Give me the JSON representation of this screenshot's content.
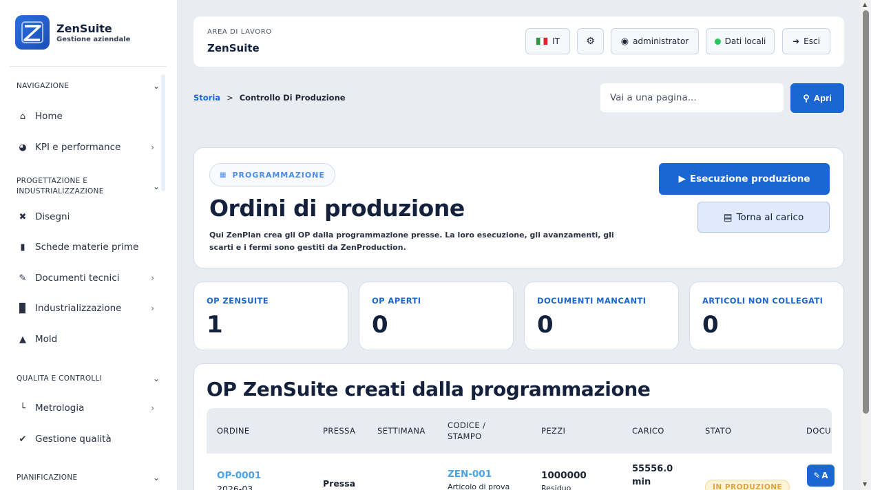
{
  "brand": {
    "name": "ZenSuite",
    "subtitle": "Gestione aziendale"
  },
  "sidebar": {
    "sections": [
      {
        "label": "NAVIGAZIONE"
      },
      {
        "label": "PROGETTAZIONE E INDUSTRIALIZZAZIONE"
      },
      {
        "label": "QUALITA E CONTROLLI"
      },
      {
        "label": "PIANIFICAZIONE"
      }
    ],
    "items": [
      {
        "label": "Home",
        "icon": "home-icon"
      },
      {
        "label": "KPI e performance",
        "icon": "pie-chart-icon"
      },
      {
        "label": "Disegni",
        "icon": "tools-icon"
      },
      {
        "label": "Schede materie prime",
        "icon": "file-icon"
      },
      {
        "label": "Documenti tecnici",
        "icon": "file-edit-icon"
      },
      {
        "label": "Industrializzazione",
        "icon": "industry-icon"
      },
      {
        "label": "Mold",
        "icon": "shapes-icon"
      },
      {
        "label": "Metrologia",
        "icon": "ruler-icon"
      },
      {
        "label": "Gestione qualità",
        "icon": "check-icon"
      }
    ]
  },
  "topbar": {
    "workspace_label": "AREA DI LAVORO",
    "workspace_name": "ZenSuite",
    "lang": "IT",
    "user": "administrator",
    "data_source": "Dati locali",
    "logout": "Esci"
  },
  "breadcrumb": {
    "root": "Storia",
    "separator": ">",
    "current": "Controllo Di Produzione"
  },
  "goto": {
    "placeholder": "Vai a una pagina...",
    "button": "Apri"
  },
  "hero": {
    "pill": "PROGRAMMAZIONE",
    "title": "Ordini di produzione",
    "description": "Qui ZenPlan crea gli OP dalla programmazione presse. La loro esecuzione, gli avanzamenti, gli scarti e i fermi sono gestiti da ZenProduction.",
    "exec_button": "Esecuzione produzione",
    "back_button": "Torna al carico"
  },
  "kpis": [
    {
      "label": "OP ZENSUITE",
      "value": "1"
    },
    {
      "label": "OP APERTI",
      "value": "0"
    },
    {
      "label": "DOCUMENTI MANCANTI",
      "value": "0"
    },
    {
      "label": "ARTICOLI NON COLLEGATI",
      "value": "0"
    }
  ],
  "table": {
    "title": "OP ZenSuite creati dalla programmazione",
    "columns": [
      "ORDINE",
      "PRESSA",
      "SETTIMANA",
      "CODICE / STAMPO",
      "PEZZI",
      "CARICO",
      "STATO",
      "DOCU"
    ],
    "rows": [
      {
        "ordine": "OP-0001",
        "ordine_sub": "2026-03",
        "pressa": "Pressa",
        "codice": "ZEN-001",
        "codice_sub": "Articolo di prova",
        "pezzi": "1000000",
        "pezzi_sub": "Residuo",
        "carico": "55556.0",
        "carico_unit": "min",
        "stato": "IN PRODUZIONE",
        "doc": "A"
      }
    ]
  }
}
